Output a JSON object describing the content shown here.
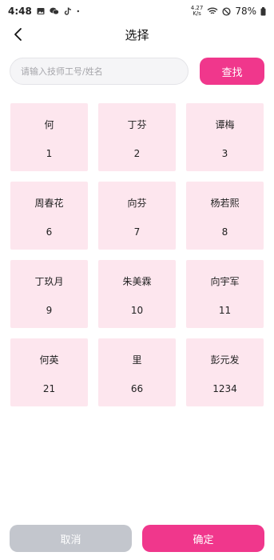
{
  "status_bar": {
    "time": "4:48",
    "net_speed_value": "4.27",
    "net_speed_unit": "K/s",
    "battery": "78%",
    "icons": [
      "gallery-icon",
      "wechat-icon",
      "tiktok-icon",
      "dot-icon",
      "wifi-icon",
      "do-not-disturb-icon",
      "battery-icon"
    ]
  },
  "header": {
    "title": "选择",
    "back_icon": "chevron-left-icon"
  },
  "search": {
    "placeholder": "请输入技师工号/姓名",
    "value": "",
    "button_label": "查找"
  },
  "technicians": [
    {
      "name": "何",
      "id": "1"
    },
    {
      "name": "丁芬",
      "id": "2"
    },
    {
      "name": "谭梅",
      "id": "3"
    },
    {
      "name": "周春花",
      "id": "6"
    },
    {
      "name": "向芬",
      "id": "7"
    },
    {
      "name": "杨若熙",
      "id": "8"
    },
    {
      "name": "丁玖月",
      "id": "9"
    },
    {
      "name": "朱美霖",
      "id": "10"
    },
    {
      "name": "向宇军",
      "id": "11"
    },
    {
      "name": "何英",
      "id": "21"
    },
    {
      "name": "里",
      "id": "66"
    },
    {
      "name": "彭元发",
      "id": "1234"
    }
  ],
  "footer": {
    "cancel_label": "取消",
    "confirm_label": "确定"
  },
  "colors": {
    "accent": "#f0378c",
    "card_bg": "#fde6ee",
    "cancel_bg": "#c3c6cd"
  }
}
